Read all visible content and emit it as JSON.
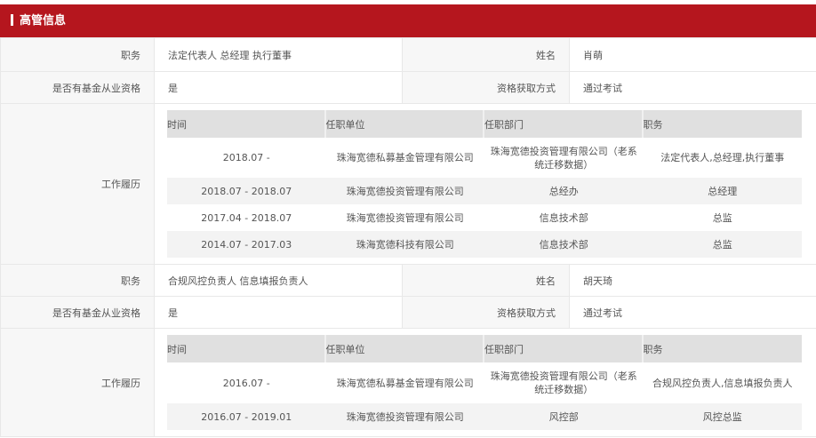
{
  "section_title": "高管信息",
  "labels": {
    "position": "职务",
    "name": "姓名",
    "qualified": "是否有基金从业资格",
    "method": "资格获取方式",
    "history": "工作履历"
  },
  "history_headers": [
    "时间",
    "任职单位",
    "任职部门",
    "职务"
  ],
  "executives": [
    {
      "position": "法定代表人 总经理 执行董事",
      "name": "肖萌",
      "qualified": "是",
      "method": "通过考试",
      "history": [
        [
          "2018.07 -",
          "珠海宽德私募基金管理有限公司",
          "珠海宽德投资管理有限公司（老系统迁移数据）",
          "法定代表人,总经理,执行董事"
        ],
        [
          "2018.07 - 2018.07",
          "珠海宽德投资管理有限公司",
          "总经办",
          "总经理"
        ],
        [
          "2017.04 - 2018.07",
          "珠海宽德投资管理有限公司",
          "信息技术部",
          "总监"
        ],
        [
          "2014.07 - 2017.03",
          "珠海宽德科技有限公司",
          "信息技术部",
          "总监"
        ]
      ]
    },
    {
      "position": "合规风控负责人 信息填报负责人",
      "name": "胡天琦",
      "qualified": "是",
      "method": "通过考试",
      "history": [
        [
          "2016.07 -",
          "珠海宽德私募基金管理有限公司",
          "珠海宽德投资管理有限公司（老系统迁移数据）",
          "合规风控负责人,信息填报负责人"
        ],
        [
          "2016.07 - 2019.01",
          "珠海宽德投资管理有限公司",
          "风控部",
          "风控总监"
        ]
      ]
    }
  ]
}
